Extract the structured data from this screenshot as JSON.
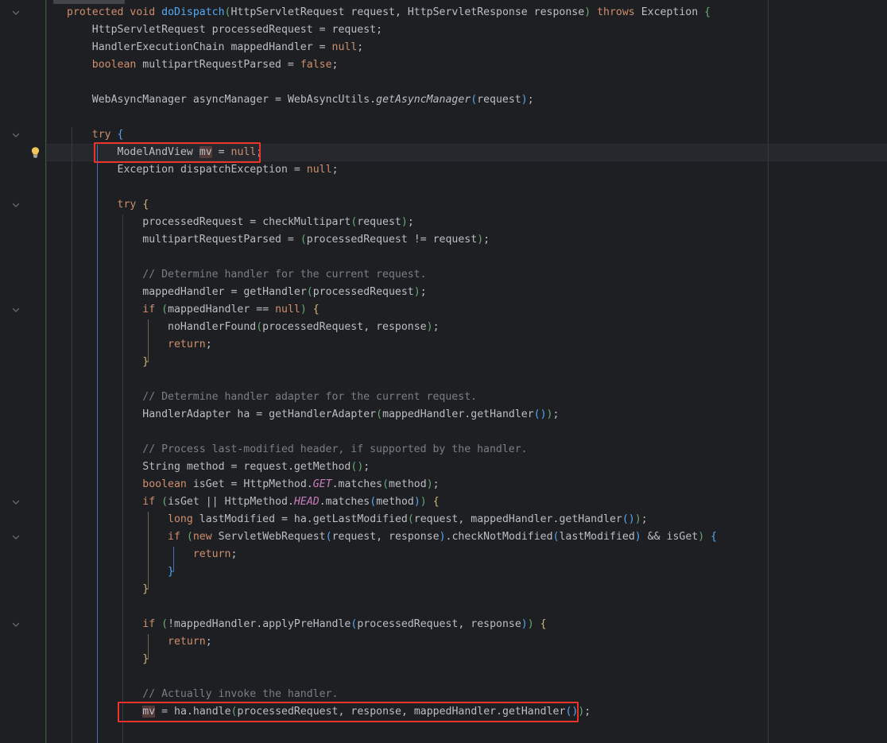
{
  "app": {
    "type": "code-editor",
    "theme": "dark",
    "language": "Java",
    "background": "#1e1f22",
    "accent_red": "#e8342b",
    "caret_line_color": "#26282e",
    "vcs_marker_color": "#375c3a"
  },
  "gutter": {
    "intention_icon": "lightbulb-icon",
    "fold_icon": "chevron-down-icon",
    "fold_rows": [
      0,
      7,
      11,
      17,
      27,
      29,
      35
    ],
    "bulb_row": 8
  },
  "annotations": {
    "boxes": [
      {
        "name": "declaration-highlight",
        "label": "ModelAndView mv = null;"
      },
      {
        "name": "assignment-highlight",
        "label": "mv = ha.handle(processedRequest, response, mappedHandler.getHandler());"
      }
    ]
  },
  "code": {
    "caret_line_index": 8,
    "lines": [
      {
        "i": 0,
        "text": "protected void doDispatch(HttpServletRequest request, HttpServletResponse response) throws Exception {"
      },
      {
        "i": 1,
        "text": "    HttpServletRequest processedRequest = request;"
      },
      {
        "i": 2,
        "text": "    HandlerExecutionChain mappedHandler = null;"
      },
      {
        "i": 3,
        "text": "    boolean multipartRequestParsed = false;"
      },
      {
        "i": 4,
        "text": ""
      },
      {
        "i": 5,
        "text": "    WebAsyncManager asyncManager = WebAsyncUtils.getAsyncManager(request);"
      },
      {
        "i": 6,
        "text": ""
      },
      {
        "i": 7,
        "text": "    try {"
      },
      {
        "i": 8,
        "text": "        ModelAndView mv = null;"
      },
      {
        "i": 9,
        "text": "        Exception dispatchException = null;"
      },
      {
        "i": 10,
        "text": ""
      },
      {
        "i": 11,
        "text": "        try {"
      },
      {
        "i": 12,
        "text": "            processedRequest = checkMultipart(request);"
      },
      {
        "i": 13,
        "text": "            multipartRequestParsed = (processedRequest != request);"
      },
      {
        "i": 14,
        "text": ""
      },
      {
        "i": 15,
        "text": "            // Determine handler for the current request."
      },
      {
        "i": 16,
        "text": "            mappedHandler = getHandler(processedRequest);"
      },
      {
        "i": 17,
        "text": "            if (mappedHandler == null) {"
      },
      {
        "i": 18,
        "text": "                noHandlerFound(processedRequest, response);"
      },
      {
        "i": 19,
        "text": "                return;"
      },
      {
        "i": 20,
        "text": "            }"
      },
      {
        "i": 21,
        "text": ""
      },
      {
        "i": 22,
        "text": "            // Determine handler adapter for the current request."
      },
      {
        "i": 23,
        "text": "            HandlerAdapter ha = getHandlerAdapter(mappedHandler.getHandler());"
      },
      {
        "i": 24,
        "text": ""
      },
      {
        "i": 25,
        "text": "            // Process last-modified header, if supported by the handler."
      },
      {
        "i": 26,
        "text": "            String method = request.getMethod();"
      },
      {
        "i": 27,
        "text": "            boolean isGet = HttpMethod.GET.matches(method);"
      },
      {
        "i": 28,
        "text": "            if (isGet || HttpMethod.HEAD.matches(method)) {"
      },
      {
        "i": 29,
        "text": "                long lastModified = ha.getLastModified(request, mappedHandler.getHandler());"
      },
      {
        "i": 30,
        "text": "                if (new ServletWebRequest(request, response).checkNotModified(lastModified) && isGet) {"
      },
      {
        "i": 31,
        "text": "                    return;"
      },
      {
        "i": 32,
        "text": "                }"
      },
      {
        "i": 33,
        "text": "            }"
      },
      {
        "i": 34,
        "text": ""
      },
      {
        "i": 35,
        "text": "            if (!mappedHandler.applyPreHandle(processedRequest, response)) {"
      },
      {
        "i": 36,
        "text": "                return;"
      },
      {
        "i": 37,
        "text": "            }"
      },
      {
        "i": 38,
        "text": ""
      },
      {
        "i": 39,
        "text": "            // Actually invoke the handler."
      },
      {
        "i": 40,
        "text": "            mv = ha.handle(processedRequest, response, mappedHandler.getHandler());"
      }
    ]
  }
}
